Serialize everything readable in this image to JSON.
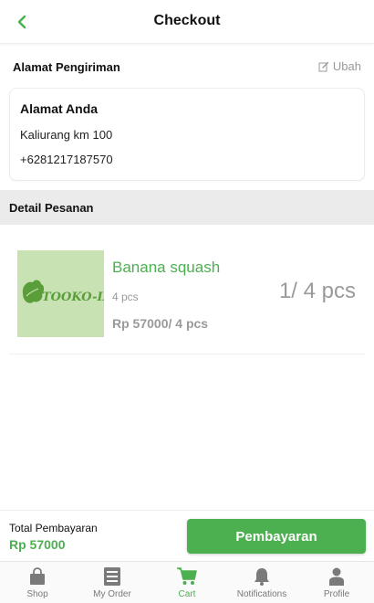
{
  "header": {
    "title": "Checkout"
  },
  "address_section": {
    "title": "Alamat Pengiriman",
    "edit_label": "Ubah",
    "card": {
      "name": "Alamat Anda",
      "street": "Kaliurang km 100",
      "phone": "+6281217187570"
    }
  },
  "detail_section": {
    "title": "Detail Pesanan"
  },
  "order_items": [
    {
      "name": "Banana squash",
      "quantity_small": "4 pcs",
      "price": "Rp 57000/ 4 pcs",
      "quantity_large": "1/ 4 pcs",
      "thumbnail_logo": "TOOKO-IN"
    }
  ],
  "total": {
    "label": "Total Pembayaran",
    "value": "Rp 57000"
  },
  "pay_button": {
    "label": "Pembayaran"
  },
  "bottom_nav": {
    "items": [
      {
        "label": "Shop",
        "icon": "shopping-bag-icon"
      },
      {
        "label": "My Order",
        "icon": "order-list-icon"
      },
      {
        "label": "Cart",
        "icon": "cart-icon",
        "active": true
      },
      {
        "label": "Notifications",
        "icon": "bell-icon"
      },
      {
        "label": "Profile",
        "icon": "person-icon"
      }
    ]
  },
  "colors": {
    "accent": "#4caf50",
    "muted_text": "#9a9a9a",
    "section_bg": "#ebebeb",
    "thumbnail_bg": "#c9e2b4"
  }
}
